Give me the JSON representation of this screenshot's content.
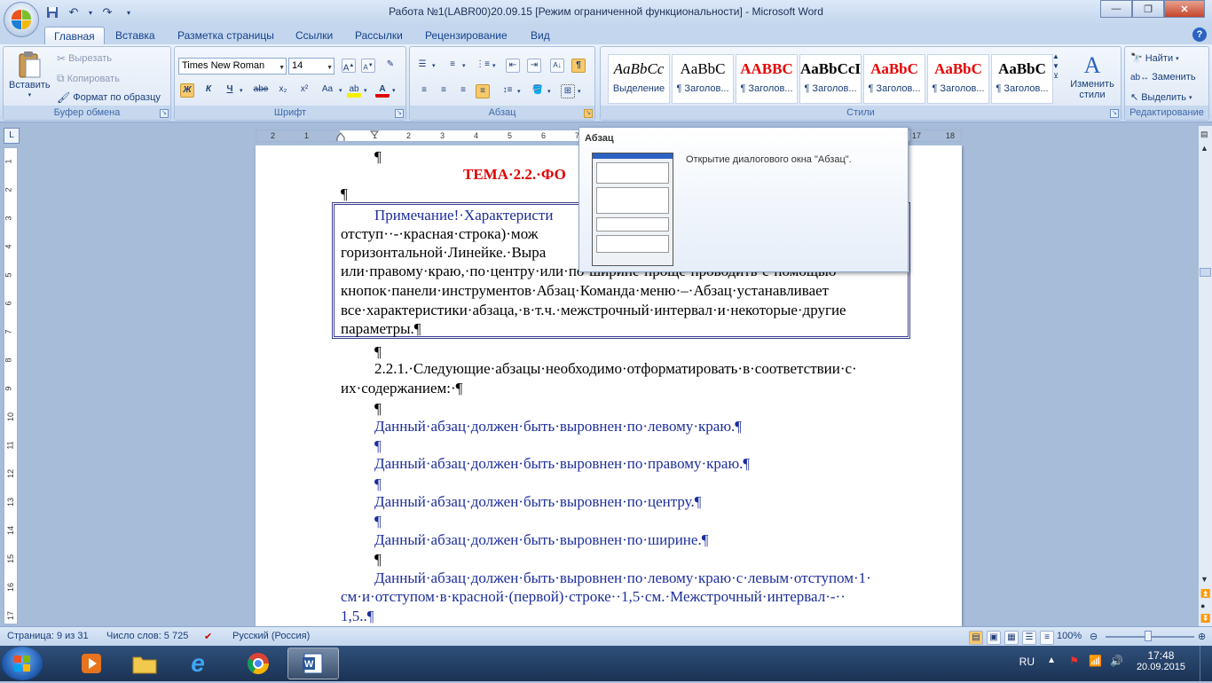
{
  "window": {
    "title": "Работа №1(LABR00)20.09.15 [Режим ограниченной функциональности] - Microsoft Word",
    "minimize": "—",
    "restore": "❐",
    "close": "✕"
  },
  "tabs": [
    "Главная",
    "Вставка",
    "Разметка страницы",
    "Ссылки",
    "Рассылки",
    "Рецензирование",
    "Вид"
  ],
  "clipboard": {
    "paste": "Вставить",
    "cut": "Вырезать",
    "copy": "Копировать",
    "format_painter": "Формат по образцу",
    "label": "Буфер обмена"
  },
  "font": {
    "name": "Times New Roman",
    "size": "14",
    "label": "Шрифт",
    "bold": "Ж",
    "italic": "К",
    "underline": "Ч",
    "strike": "abe",
    "subscript": "x₂",
    "superscript": "x²",
    "change_case": "Aa"
  },
  "paragraph": {
    "label": "Абзац"
  },
  "styles": {
    "label": "Стили",
    "items": [
      {
        "sample": "AaBbCc",
        "name": "Выделение",
        "color": "#000000"
      },
      {
        "sample": "AaBbC",
        "name": "¶ Заголов...",
        "color": "#000000"
      },
      {
        "sample": "AABBC",
        "name": "¶ Заголов...",
        "color": "#e60000"
      },
      {
        "sample": "AaBbCcI",
        "name": "¶ Заголов...",
        "color": "#000000"
      },
      {
        "sample": "AaBbC",
        "name": "¶ Заголов...",
        "color": "#e60000"
      },
      {
        "sample": "AaBbC",
        "name": "¶ Заголов...",
        "color": "#e60000"
      },
      {
        "sample": "AaBbC",
        "name": "¶ Заголов...",
        "color": "#000000"
      }
    ],
    "change": "Изменить стили"
  },
  "editing": {
    "find": "Найти",
    "replace": "Заменить",
    "select": "Выделить",
    "label": "Редактирование"
  },
  "ruler": {
    "corner": "L",
    "left_numbers": [
      "2",
      "1"
    ],
    "numbers": [
      "1",
      "2",
      "3",
      "4",
      "5",
      "6",
      "7",
      "8",
      "9",
      "10",
      "11",
      "12",
      "13",
      "14",
      "15",
      "16",
      "17",
      "18"
    ],
    "vertical_numbers": [
      "1",
      "2",
      "3",
      "4",
      "5",
      "6",
      "7",
      "8",
      "9",
      "10",
      "11",
      "12",
      "13",
      "14",
      "15",
      "16",
      "17"
    ]
  },
  "tooltip": {
    "title": "Абзац",
    "description": "Открытие диалогового окна \"Абзац\"."
  },
  "document": {
    "mark_top": "¶",
    "heading": "ТЕМА·2.2.·ФО",
    "mark_after_heading": "¶",
    "note_lines": [
      "Примечание!·Характеристи",
      "отступ··-·красная·строка)·мож",
      "горизонтальной·Линейке.·Выра",
      "или·правому·краю,·по·центру·или·по·ширине·проще·проводить·с·помощью",
      "кнопок·панели·инструментов·Абзац·Команда·меню·–·Абзац·устанавливает",
      "все·характеристики·абзаца,·в·т.ч.·межстрочный·интервал·и·некоторые·другие",
      "параметры.¶"
    ],
    "mark_after_note": "¶",
    "task_line1": "2.2.1.·Следующие·абзацы·необходимо·отформатировать·в·соответствии·с·",
    "task_line2": "их·содержанием:·¶",
    "mark1": "¶",
    "p_left": "Данный·абзац·должен·быть·выровнен·по·левому·краю.¶",
    "mark2": "¶",
    "p_right": "Данный·абзац·должен·быть·выровнен·по·правому·краю.¶",
    "mark3": "¶",
    "p_center": "Данный·абзац·должен·быть·выровнен·по·центру.¶",
    "mark4": "¶",
    "p_justify": "Данный·абзац·должен·быть·выровнен·по·ширине.¶",
    "mark5": "¶",
    "p_indent1": "Данный·абзац·должен·быть·выровнен·по·левому·краю·с·левым·отступом·1·",
    "p_indent2": "см·и·отступом·в·красной·(первой)·строке··1,5·см.·Межстрочный·интервал·-··",
    "p_indent3": "1,5..¶"
  },
  "status": {
    "page": "Страница: 9 из 31",
    "words": "Число слов: 5 725",
    "language": "Русский (Россия)",
    "zoom": "100%"
  },
  "tray": {
    "lang": "RU",
    "time": "17:48",
    "date": "20.09.2015"
  }
}
